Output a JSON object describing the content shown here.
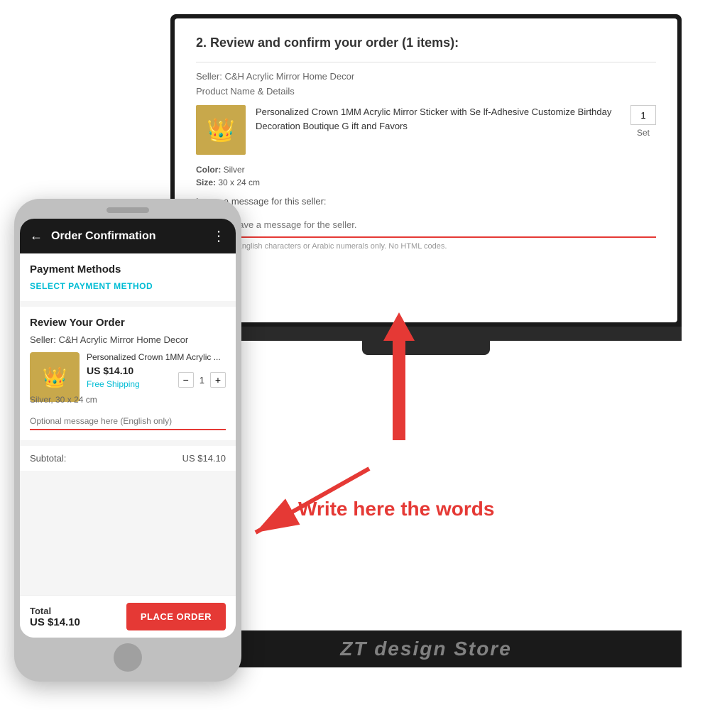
{
  "monitor": {
    "section_title": "2. Review and confirm your order (1 items):",
    "seller_label": "Seller: C&H Acrylic Mirror Home Decor",
    "product_label": "Product Name & Details",
    "product": {
      "name": "Personalized Crown 1MM Acrylic Mirror Sticker with Se lf-Adhesive Customize Birthday Decoration Boutique G ift and Favors",
      "color_label": "Color:",
      "color_value": "Silver",
      "size_label": "Size:",
      "size_value": "30 x 24 cm",
      "qty": "1",
      "unit": "Set"
    },
    "message_label": "Leave a message for this seller:",
    "message_placeholder": "You can leave a message for the seller.",
    "message_hint": "Max. 1,000 English characters or Arabic numerals only. No HTML codes.",
    "crown_emoji": "👑"
  },
  "watermark": "ZT design Store",
  "phone": {
    "header": {
      "title": "Order Confirmation",
      "back_label": "←",
      "more_label": "⋮"
    },
    "payment": {
      "section_title": "Payment Methods",
      "select_btn": "SELECT PAYMENT METHOD"
    },
    "review": {
      "section_title": "Review Your Order",
      "seller_text": "Seller: C&H Acrylic Mirror Home Decor"
    },
    "product": {
      "name_short": "Personalized Crown 1MM Acrylic ...",
      "price": "US $14.10",
      "shipping": "Free Shipping",
      "qty": "1",
      "variant": "Silver, 30 x 24 cm",
      "crown_emoji": "👑"
    },
    "message_placeholder": "Optional message here (English only)",
    "subtotal_label": "Subtotal:",
    "subtotal_value": "US $14.10",
    "total_label": "Total",
    "total_amount": "US $14.10",
    "place_order_btn": "PLACE ORDER"
  },
  "annotation": {
    "write_here": "Write here the words"
  }
}
